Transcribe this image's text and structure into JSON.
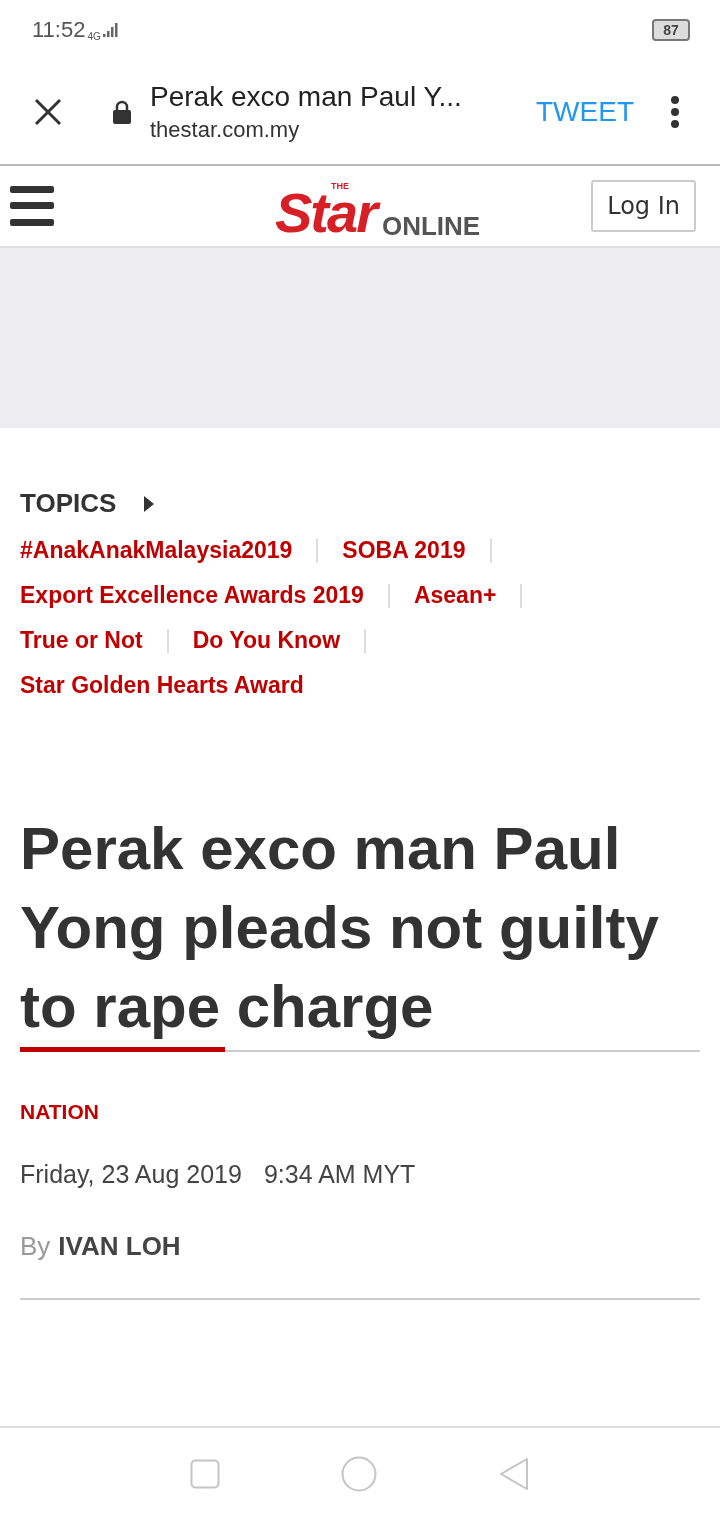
{
  "status_bar": {
    "time": "11:52",
    "network": "4G",
    "battery": "87"
  },
  "browser_bar": {
    "page_title": "Perak exco man Paul Y...",
    "domain": "thestar.com.my",
    "action": "TWEET"
  },
  "site_header": {
    "logo": {
      "the": "THE",
      "star": "Star",
      "online": "ONLINE"
    },
    "login": "Log In"
  },
  "ad_slot": {
    "kind": "blank"
  },
  "topics": {
    "heading": "TOPICS",
    "items": [
      {
        "label": "#AnakAnakMalaysia2019"
      },
      {
        "label": "SOBA 2019"
      },
      {
        "label": "Export Excellence Awards 2019"
      },
      {
        "label": "Asean+"
      },
      {
        "label": "True or Not"
      },
      {
        "label": "Do You Know"
      },
      {
        "label": "Star Golden Hearts Award"
      }
    ]
  },
  "article": {
    "headline": "Perak exco man Paul Yong pleads not guilty to rape charge",
    "section": "NATION",
    "date": "Friday, 23 Aug 2019",
    "time": "9:34 AM MYT",
    "byline_prefix": "By",
    "author": "IVAN LOH"
  }
}
